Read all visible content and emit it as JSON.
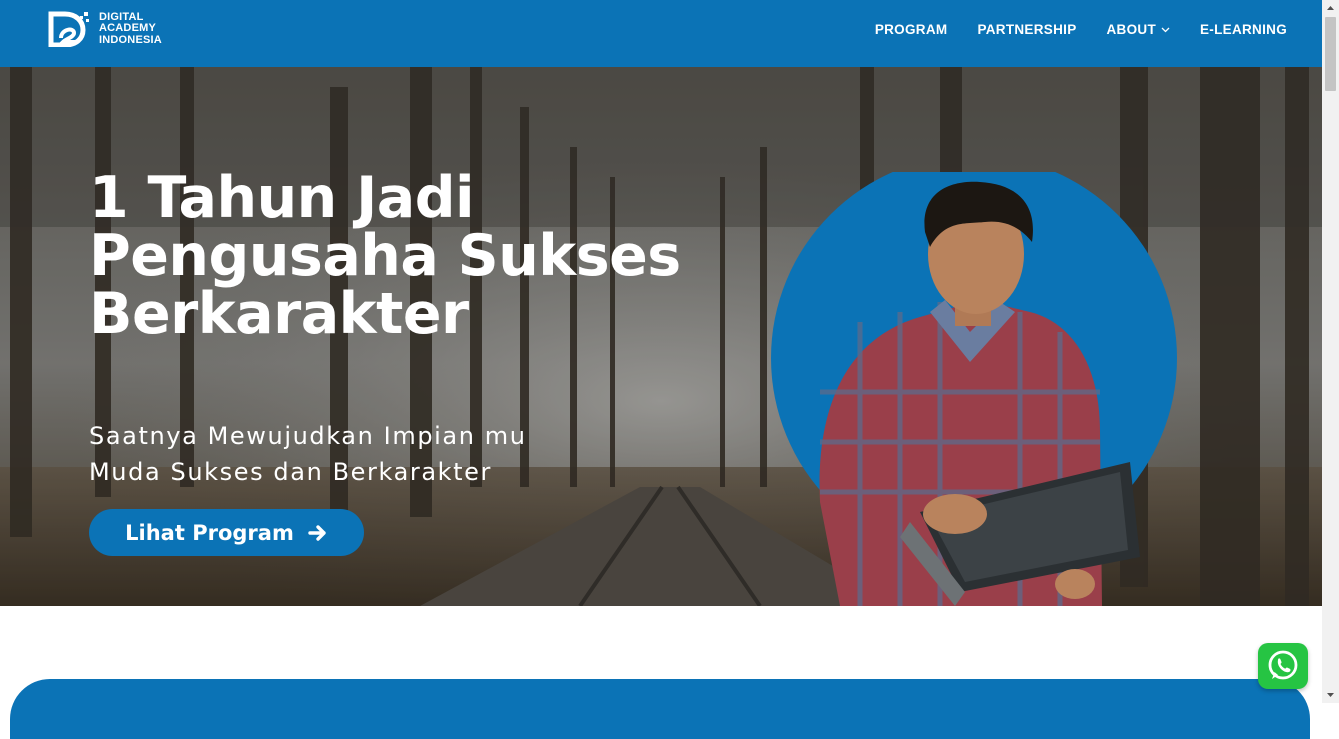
{
  "brand": {
    "name_lines": [
      "DIGITAL",
      "ACADEMY",
      "INDONESIA"
    ],
    "logo_icon": "d2-logo-icon"
  },
  "nav": {
    "items": [
      {
        "label": "PROGRAM",
        "dropdown": false
      },
      {
        "label": "PARTNERSHIP",
        "dropdown": false
      },
      {
        "label": "ABOUT",
        "dropdown": true
      },
      {
        "label": "E-LEARNING",
        "dropdown": false
      }
    ]
  },
  "hero": {
    "title_lines": [
      "1 Tahun Jadi",
      "Pengusaha Sukses",
      "Berkarakter"
    ],
    "subtitle_lines": [
      "Saatnya Mewujudkan Impian mu",
      "Muda Sukses dan Berkarakter"
    ],
    "cta_label": "Lihat Program",
    "cta_icon": "arrow-right-icon"
  },
  "floating": {
    "whatsapp_icon": "whatsapp-icon"
  },
  "colors": {
    "brand_blue": "#0b73b6",
    "whatsapp_green": "#26c443",
    "white": "#ffffff"
  }
}
